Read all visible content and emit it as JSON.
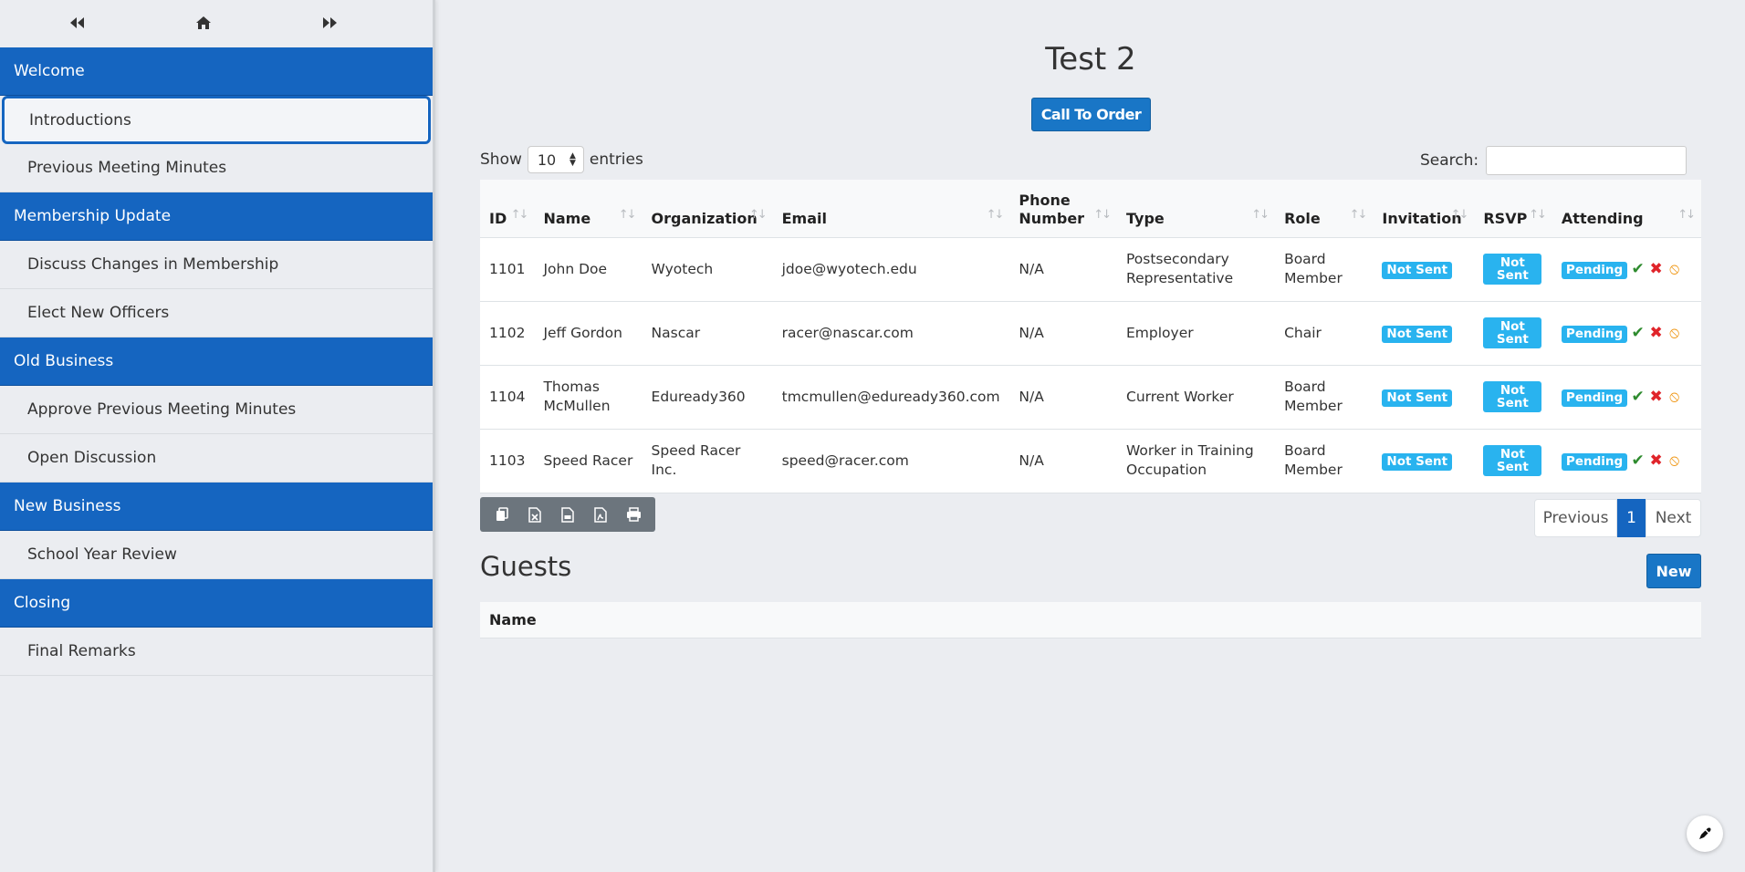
{
  "sidebar": {
    "nav": {
      "prev_icon": "double-chevron-left-icon",
      "home_icon": "home-icon",
      "next_icon": "double-chevron-right-icon"
    },
    "sections": [
      {
        "title": "Welcome",
        "items": [
          "Introductions",
          "Previous Meeting Minutes"
        ]
      },
      {
        "title": "Membership Update",
        "items": [
          "Discuss Changes in Membership",
          "Elect New Officers"
        ]
      },
      {
        "title": "Old Business",
        "items": [
          "Approve Previous Meeting Minutes",
          "Open Discussion"
        ]
      },
      {
        "title": "New Business",
        "items": [
          "School Year Review"
        ]
      },
      {
        "title": "Closing",
        "items": [
          "Final Remarks"
        ]
      }
    ],
    "active_item": "Introductions"
  },
  "main": {
    "title": "Test 2",
    "call_to_order": "Call To Order",
    "show_label": "Show",
    "show_value": "10",
    "entries_label": "entries",
    "search_label": "Search:",
    "search_value": "",
    "table": {
      "columns": [
        "ID",
        "Name",
        "Organization",
        "Email",
        "Phone Number",
        "Type",
        "Role",
        "Invitation",
        "RSVP",
        "Attending"
      ],
      "rows": [
        {
          "id": "1101",
          "name": "John Doe",
          "organization": "Wyotech",
          "email": "jdoe@wyotech.edu",
          "phone": "N/A",
          "type": "Postsecondary Representative",
          "role": "Board Member",
          "invitation": "Not Sent",
          "rsvp": "Not Sent",
          "attending": "Pending"
        },
        {
          "id": "1102",
          "name": "Jeff Gordon",
          "organization": "Nascar",
          "email": "racer@nascar.com",
          "phone": "N/A",
          "type": "Employer",
          "role": "Chair",
          "invitation": "Not Sent",
          "rsvp": "Not Sent",
          "attending": "Pending"
        },
        {
          "id": "1104",
          "name": "Thomas McMullen",
          "organization": "Eduready360",
          "email": "tmcmullen@eduready360.com",
          "phone": "N/A",
          "type": "Current Worker",
          "role": "Board Member",
          "invitation": "Not Sent",
          "rsvp": "Not Sent",
          "attending": "Pending"
        },
        {
          "id": "1103",
          "name": "Speed Racer",
          "organization": "Speed Racer Inc.",
          "email": "speed@racer.com",
          "phone": "N/A",
          "type": "Worker in Training Occupation",
          "role": "Board Member",
          "invitation": "Not Sent",
          "rsvp": "Not Sent",
          "attending": "Pending"
        }
      ]
    },
    "export_buttons": [
      "copy-icon",
      "excel-icon",
      "csv-icon",
      "pdf-icon",
      "print-icon"
    ],
    "pagination": {
      "previous": "Previous",
      "current": "1",
      "next": "Next"
    },
    "guests": {
      "title": "Guests",
      "new_label": "New",
      "columns": [
        "Name"
      ]
    }
  },
  "colors": {
    "accent": "#1565c0",
    "badge": "#29b3ef",
    "check": "#2e8b2e",
    "cross": "#e0242a",
    "ban": "#f09a1c"
  }
}
